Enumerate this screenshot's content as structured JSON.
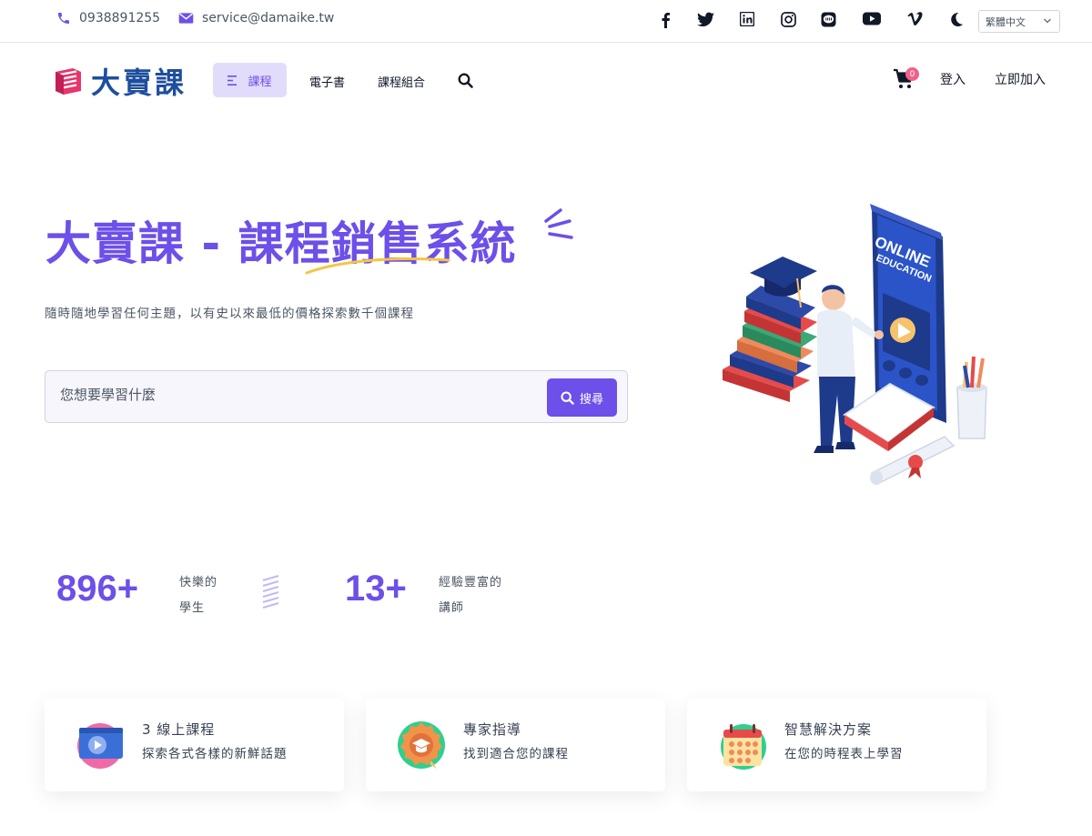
{
  "topbar": {
    "phone": "0938891255",
    "email": "service@damaike.tw",
    "social_icons": [
      "facebook-icon",
      "twitter-icon",
      "linkedin-icon",
      "instagram-icon",
      "line-icon",
      "youtube-icon",
      "vimeo-icon",
      "dark-mode-icon"
    ],
    "language": "繁體中文"
  },
  "nav": {
    "logo_text": "大賣課",
    "courses_label": "課程",
    "ebooks_label": "電子書",
    "bundles_label": "課程組合",
    "cart_count": "0",
    "login_label": "登入",
    "join_label": "立即加入"
  },
  "hero": {
    "title_part1": "大賣課 - ",
    "title_part2": "課程銷售系統",
    "subtitle": "隨時隨地學習任何主題，以有史以來最低的價格探索數千個課程",
    "search_placeholder": "您想要學習什麼",
    "search_button": "搜尋"
  },
  "stats": [
    {
      "number": "896+",
      "label_line1": "快樂的",
      "label_line2": "學生"
    },
    {
      "number": "13+",
      "label_line1": "經驗豐富的",
      "label_line2": "講師"
    }
  ],
  "features": [
    {
      "icon": "video-course-icon",
      "title": "3 線上課程",
      "desc": "探索各式各樣的新鮮話題"
    },
    {
      "icon": "graduation-badge-icon",
      "title": "專家指導",
      "desc": "找到適合您的課程"
    },
    {
      "icon": "calendar-icon",
      "title": "智慧解決方案",
      "desc": "在您的時程表上學習"
    }
  ],
  "colors": {
    "accent": "#6d4fe9",
    "logo_blue": "#1d4e9e",
    "badge": "#f0618c"
  }
}
